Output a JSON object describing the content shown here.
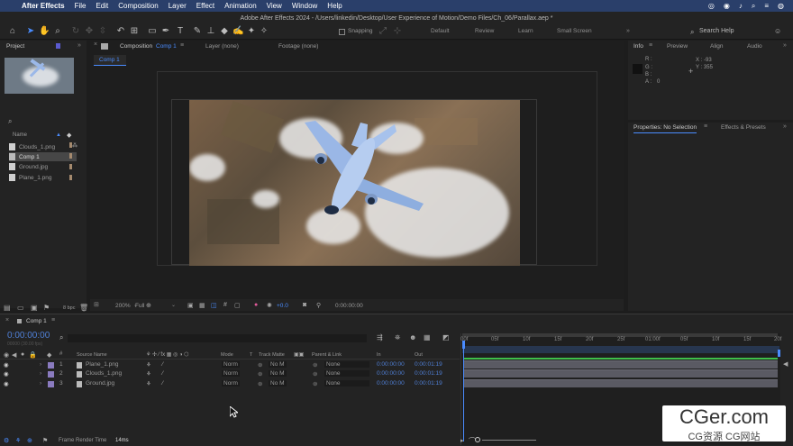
{
  "menubar": {
    "apple": "",
    "app": "After Effects",
    "items": [
      "File",
      "Edit",
      "Composition",
      "Layer",
      "Effect",
      "Animation",
      "View",
      "Window",
      "Help"
    ]
  },
  "window": {
    "title": "Adobe After Effects 2024 - /Users/linkedin/Desktop/User Experience of Motion/Demo Files/Ch_06/Parallax.aep *"
  },
  "toolbar": {
    "snapping_label": "Snapping",
    "workspaces": [
      "Default",
      "Review",
      "Learn",
      "Small Screen"
    ],
    "search_placeholder": "Search Help"
  },
  "project": {
    "tab": "Project",
    "col_name": "Name",
    "bpc": "8 bpc",
    "files": [
      {
        "name": "Clouds_1.png"
      },
      {
        "name": "Comp 1",
        "selected": true
      },
      {
        "name": "Ground.jpg"
      },
      {
        "name": "Plane_1.png"
      }
    ]
  },
  "viewer": {
    "tab_prefix": "Composition",
    "tab_name": "Comp 1",
    "layer_tab": "Layer (none)",
    "footage_tab": "Footage (none)",
    "breadcrumb": "Comp 1",
    "zoom": "200%",
    "resolution": "Full",
    "exposure": "+0.0",
    "timecode": "0:00:00:00"
  },
  "info": {
    "tab": "Info",
    "preview_tab": "Preview",
    "align_tab": "Align",
    "audio_tab": "Audio",
    "r": "R :",
    "g": "G :",
    "b": "B :",
    "a": "A :",
    "a_val": "0",
    "x": "X : -93",
    "y": "Y : 355"
  },
  "properties": {
    "tab": "Properties: No Selection",
    "effects_tab": "Effects & Presets"
  },
  "timeline": {
    "tab": "Comp 1",
    "timecode": "0:00:00:00",
    "fps": "00000 (30.00 fps)",
    "cols": {
      "source": "Source Name",
      "mode": "Mode",
      "t": "T",
      "trackmatte": "Track Matte",
      "parent": "Parent & Link",
      "in": "In",
      "out": "Out"
    },
    "layers": [
      {
        "num": "1",
        "name": "Plane_1.png",
        "mode": "Norm",
        "matte": "No M",
        "parent": "None",
        "in": "0:00:00:00",
        "out": "0:00:01:19"
      },
      {
        "num": "2",
        "name": "Clouds_1.png",
        "mode": "Norm",
        "matte": "No M",
        "parent": "None",
        "in": "0:00:00:00",
        "out": "0:00:01:19"
      },
      {
        "num": "3",
        "name": "Ground.jpg",
        "mode": "Norm",
        "matte": "No M",
        "parent": "None",
        "in": "0:00:00:00",
        "out": "0:00:01:19"
      }
    ],
    "ruler": [
      "00f",
      "05f",
      "10f",
      "15f",
      "20f",
      "25f",
      "01:00f",
      "05f",
      "10f",
      "15f",
      "20f"
    ],
    "render_label": "Frame Render Time",
    "render_value": "14ms"
  },
  "watermark": {
    "line1": "CGer.com",
    "line2": "CG资源 CG网站"
  }
}
